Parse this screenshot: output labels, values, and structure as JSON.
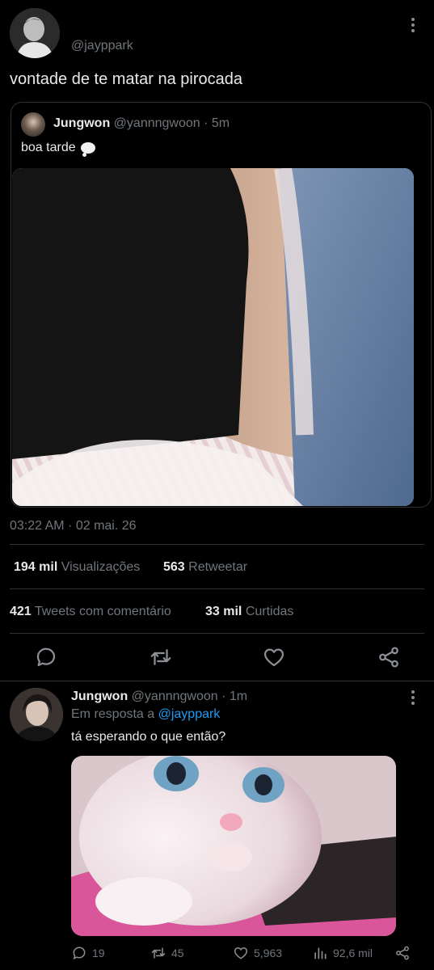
{
  "main_tweet": {
    "handle": "@jayppark",
    "text": "vontade de te matar na pirocada",
    "timestamp": "03:22 AM · 02 mai. 26",
    "icons": [
      "more-vertical-icon"
    ]
  },
  "quoted_tweet": {
    "name": "Jungwon",
    "handle": "@yannngwoon",
    "time": "· 5m",
    "text": "boa tarde",
    "emoji_icon": "thought-balloon-icon"
  },
  "stats": {
    "views_count": "194 mil",
    "views_label": "Visualizações",
    "retweets_count": "563",
    "retweets_label": "Retweetar",
    "quotes_count": "421",
    "quotes_label": "Tweets com comentário",
    "likes_count": "33 mil",
    "likes_label": "Curtidas"
  },
  "action_bar": [
    "reply-icon",
    "retweet-icon",
    "like-icon",
    "share-icon"
  ],
  "reply": {
    "name": "Jungwon",
    "handle": "@yannngwoon",
    "time": "· 1m",
    "reply_prefix": "Em resposta a",
    "reply_to": "@jayppark",
    "text": "tá esperando o que então?",
    "counts": {
      "replies": "19",
      "retweets": "45",
      "likes": "5,963",
      "views": "92,6 mil"
    }
  },
  "colors": {
    "background": "#000000",
    "text": "#e7e9ea",
    "muted": "#71767b",
    "link": "#1d9bf0",
    "divider": "#2f3336"
  }
}
